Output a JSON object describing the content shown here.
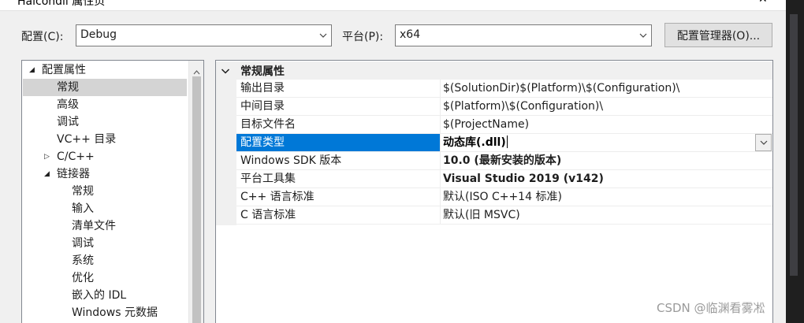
{
  "window": {
    "title": "Halcondll 属性页",
    "close_glyph": "✕"
  },
  "toolbar": {
    "config_label": "配置(C):",
    "config_value": "Debug",
    "platform_label": "平台(P):",
    "platform_value": "x64",
    "config_manager_label": "配置管理器(O)..."
  },
  "tree": {
    "nodes": [
      {
        "label": "配置属性",
        "expander": "◢"
      },
      {
        "label": "常规"
      },
      {
        "label": "高级"
      },
      {
        "label": "调试"
      },
      {
        "label": "VC++ 目录"
      },
      {
        "label": "C/C++",
        "expander": "▷"
      },
      {
        "label": "链接器",
        "expander": "◢"
      },
      {
        "label": "常规"
      },
      {
        "label": "输入"
      },
      {
        "label": "清单文件"
      },
      {
        "label": "调试"
      },
      {
        "label": "系统"
      },
      {
        "label": "优化"
      },
      {
        "label": "嵌入的 IDL"
      },
      {
        "label": "Windows 元数据"
      }
    ],
    "selected_index": 1
  },
  "grid": {
    "category": "常规属性",
    "rows": [
      {
        "name": "输出目录",
        "value": "$(SolutionDir)$(Platform)\\$(Configuration)\\",
        "bold": false
      },
      {
        "name": "中间目录",
        "value": "$(Platform)\\$(Configuration)\\",
        "bold": false
      },
      {
        "name": "目标文件名",
        "value": "$(ProjectName)",
        "bold": false
      },
      {
        "name": "配置类型",
        "value": "动态库(.dll)",
        "bold": true
      },
      {
        "name": "Windows SDK 版本",
        "value": "10.0 (最新安装的版本)",
        "bold": true
      },
      {
        "name": "平台工具集",
        "value": "Visual Studio 2019 (v142)",
        "bold": true
      },
      {
        "name": "C++ 语言标准",
        "value": "默认(ISO C++14 标准)",
        "bold": false
      },
      {
        "name": "C 语言标准",
        "value": "默认(旧 MSVC)",
        "bold": false
      }
    ],
    "selected_index": 3
  },
  "watermark": "CSDN @临渊看雾凇",
  "colors": {
    "selection": "#0078d7",
    "tree_selection": "#d4d4d4",
    "dialog_bg": "#f0f0f0"
  }
}
